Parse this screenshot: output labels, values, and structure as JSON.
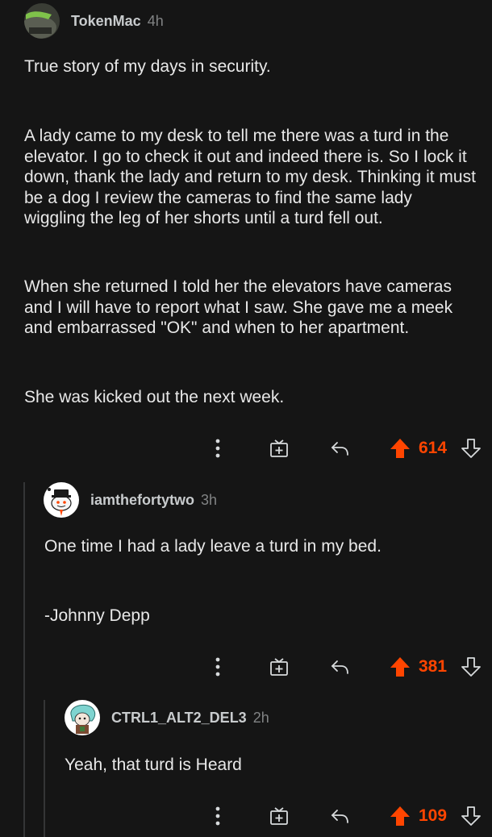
{
  "comments": [
    {
      "username": "TokenMac",
      "age": "4h",
      "paragraphs": [
        "True story of my days in security.",
        "A lady came to my desk to tell me there was a turd in the elevator. I go to check it out and indeed there is. So I lock it down, thank the lady and return to my desk. Thinking it must be a dog I review the cameras to find the same lady wiggling the leg of her shorts until a turd fell out.",
        "When she returned I told her the elevators have cameras and I will have to report what I saw. She gave me a meek and embarrassed \"OK\" and when to her apartment.",
        "She was kicked out the next week."
      ],
      "score": "614"
    },
    {
      "username": "iamthefortytwo",
      "age": "3h",
      "paragraphs": [
        "One time I had a lady leave a turd in my bed.",
        "-Johnny Depp"
      ],
      "score": "381"
    },
    {
      "username": "CTRL1_ALT2_DEL3",
      "age": "2h",
      "paragraphs": [
        "Yeah, that turd is Heard"
      ],
      "score": "109"
    }
  ],
  "icons": {
    "more": "more-vertical-icon",
    "award": "award-icon",
    "reply": "reply-icon",
    "upvote": "upvote-arrow-icon",
    "downvote": "downvote-arrow-icon"
  },
  "colors": {
    "background": "#151515",
    "upvoted": "#ff4500",
    "text": "#e8e8e8",
    "muted": "#818384"
  }
}
